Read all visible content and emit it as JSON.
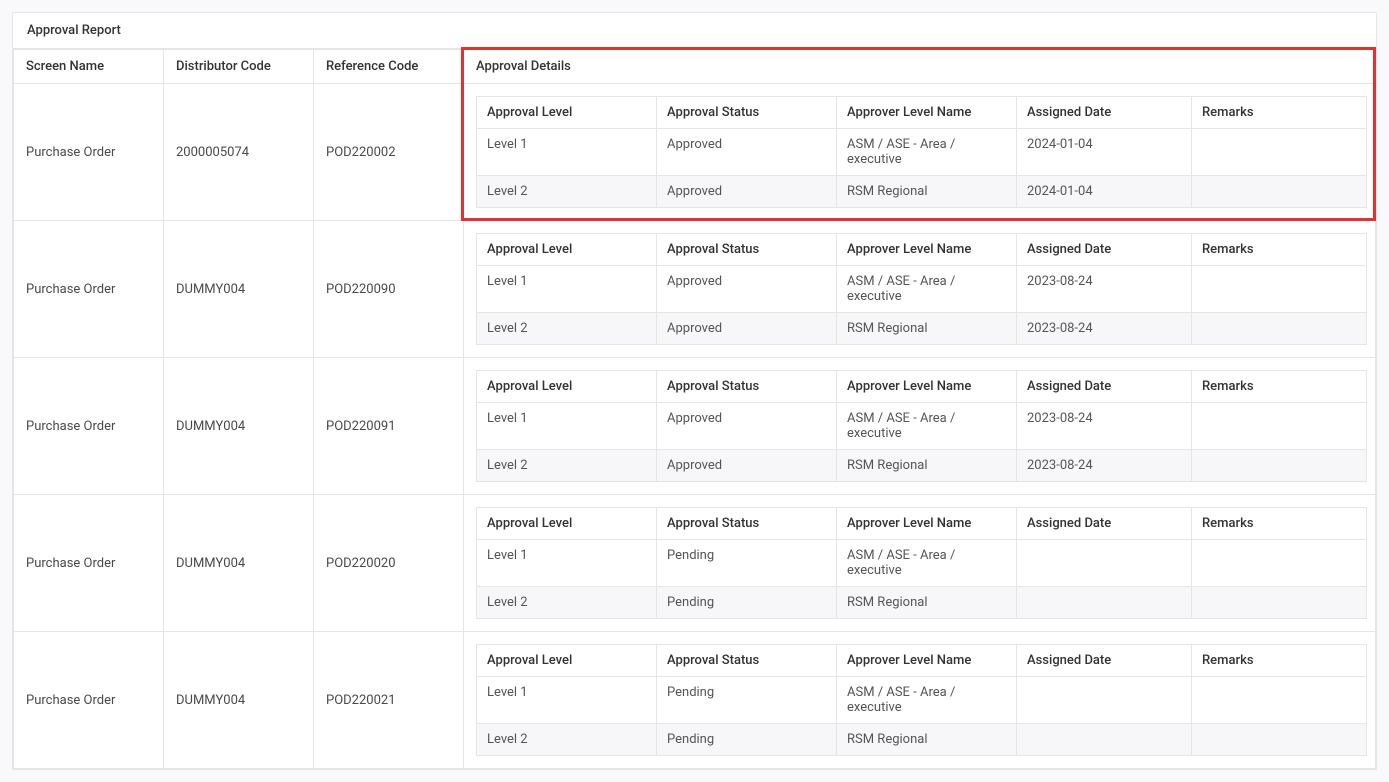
{
  "report": {
    "title": "Approval Report",
    "columns": {
      "screen_name": "Screen Name",
      "distributor_code": "Distributor Code",
      "reference_code": "Reference Code",
      "approval_details": "Approval Details"
    },
    "detail_columns": {
      "approval_level": "Approval Level",
      "approval_status": "Approval Status",
      "approver_level_name": "Approver Level Name",
      "assigned_date": "Assigned Date",
      "remarks": "Remarks"
    },
    "rows": [
      {
        "screen_name": "Purchase Order",
        "distributor_code": "2000005074",
        "reference_code": "POD220002",
        "details": [
          {
            "approval_level": "Level 1",
            "approval_status": "Approved",
            "approver_level_name": "ASM / ASE - Area / executive",
            "assigned_date": "2024-01-04",
            "remarks": ""
          },
          {
            "approval_level": "Level 2",
            "approval_status": "Approved",
            "approver_level_name": "RSM Regional",
            "assigned_date": "2024-01-04",
            "remarks": ""
          }
        ]
      },
      {
        "screen_name": "Purchase Order",
        "distributor_code": "DUMMY004",
        "reference_code": "POD220090",
        "details": [
          {
            "approval_level": "Level 1",
            "approval_status": "Approved",
            "approver_level_name": "ASM / ASE - Area / executive",
            "assigned_date": "2023-08-24",
            "remarks": ""
          },
          {
            "approval_level": "Level 2",
            "approval_status": "Approved",
            "approver_level_name": "RSM Regional",
            "assigned_date": "2023-08-24",
            "remarks": ""
          }
        ]
      },
      {
        "screen_name": "Purchase Order",
        "distributor_code": "DUMMY004",
        "reference_code": "POD220091",
        "details": [
          {
            "approval_level": "Level 1",
            "approval_status": "Approved",
            "approver_level_name": "ASM / ASE - Area / executive",
            "assigned_date": "2023-08-24",
            "remarks": ""
          },
          {
            "approval_level": "Level 2",
            "approval_status": "Approved",
            "approver_level_name": "RSM Regional",
            "assigned_date": "2023-08-24",
            "remarks": ""
          }
        ]
      },
      {
        "screen_name": "Purchase Order",
        "distributor_code": "DUMMY004",
        "reference_code": "POD220020",
        "details": [
          {
            "approval_level": "Level 1",
            "approval_status": "Pending",
            "approver_level_name": "ASM / ASE - Area / executive",
            "assigned_date": "",
            "remarks": ""
          },
          {
            "approval_level": "Level 2",
            "approval_status": "Pending",
            "approver_level_name": "RSM Regional",
            "assigned_date": "",
            "remarks": ""
          }
        ]
      },
      {
        "screen_name": "Purchase Order",
        "distributor_code": "DUMMY004",
        "reference_code": "POD220021",
        "details": [
          {
            "approval_level": "Level 1",
            "approval_status": "Pending",
            "approver_level_name": "ASM / ASE - Area / executive",
            "assigned_date": "",
            "remarks": ""
          },
          {
            "approval_level": "Level 2",
            "approval_status": "Pending",
            "approver_level_name": "RSM Regional",
            "assigned_date": "",
            "remarks": ""
          }
        ]
      }
    ]
  }
}
